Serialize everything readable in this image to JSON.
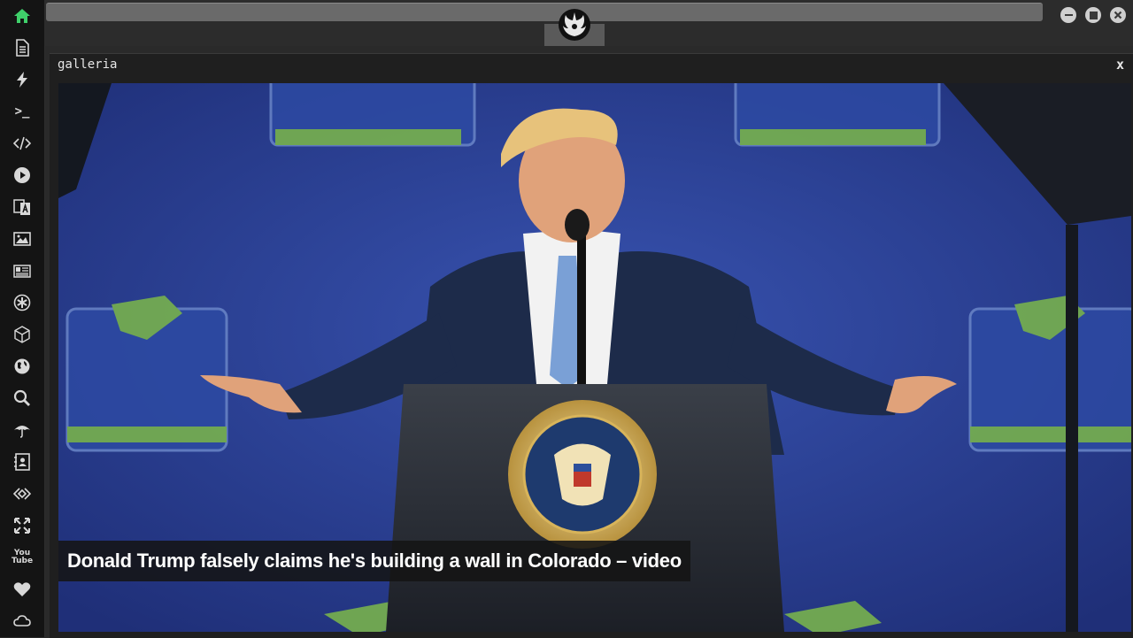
{
  "sidebar": {
    "items": [
      {
        "icon": "home-icon"
      },
      {
        "icon": "document-icon"
      },
      {
        "icon": "lightning-icon"
      },
      {
        "icon": "terminal-icon",
        "glyph": ">_"
      },
      {
        "icon": "code-icon"
      },
      {
        "icon": "play-icon"
      },
      {
        "icon": "translate-icon"
      },
      {
        "icon": "image-icon"
      },
      {
        "icon": "news-icon"
      },
      {
        "icon": "settings-asterisk-icon"
      },
      {
        "icon": "cube-icon"
      },
      {
        "icon": "globe-icon"
      },
      {
        "icon": "search-icon"
      },
      {
        "icon": "umbrella-icon"
      },
      {
        "icon": "contacts-icon"
      },
      {
        "icon": "diamond-code-icon"
      },
      {
        "icon": "expand-icon"
      },
      {
        "icon": "youtube-icon",
        "glyph_top": "You",
        "glyph_bottom": "Tube"
      },
      {
        "icon": "heart-icon"
      },
      {
        "icon": "cloud-icon"
      }
    ],
    "active_color": "#3fd06a"
  },
  "window": {
    "controls": [
      {
        "icon": "minimize-icon"
      },
      {
        "icon": "maximize-icon"
      },
      {
        "icon": "close-icon"
      }
    ]
  },
  "gallery": {
    "title": "galleria",
    "close_label": "x",
    "caption": "Donald Trump falsely claims he's building a wall in Colorado – video"
  },
  "colors": {
    "backdrop": "#2b3f8e",
    "banner_green": "#7cb84a"
  }
}
